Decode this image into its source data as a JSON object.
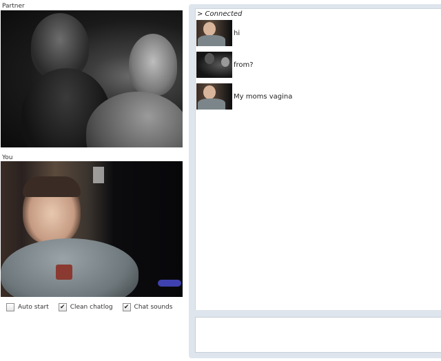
{
  "partner_label": "Partner",
  "you_label": "You",
  "options": [
    {
      "label": "Auto start",
      "checked": false
    },
    {
      "label": "Clean chatlog",
      "checked": true
    },
    {
      "label": "Chat sounds",
      "checked": true
    }
  ],
  "check_glyph": "✔",
  "chat": {
    "status": "> Connected",
    "messages": [
      {
        "sender": "you",
        "text": "hi"
      },
      {
        "sender": "partner",
        "text": "from?"
      },
      {
        "sender": "you",
        "text": "My moms vagina"
      }
    ],
    "input_value": ""
  },
  "colors": {
    "chat_frame": "#dfe5ec",
    "page_background": "#ffffff"
  }
}
